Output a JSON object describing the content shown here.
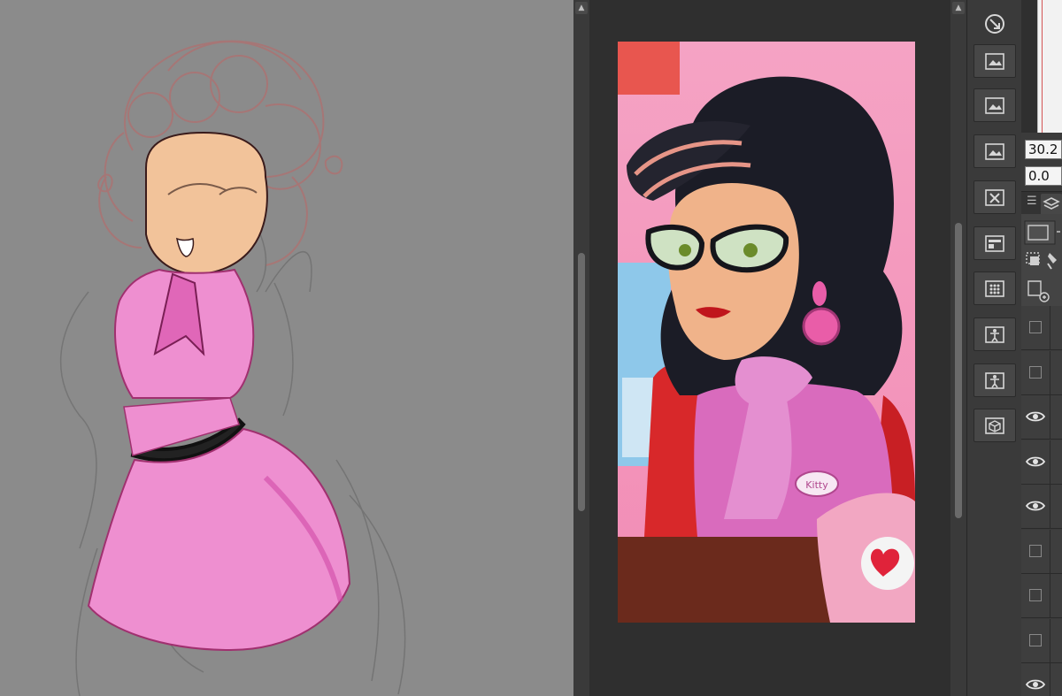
{
  "colors": {
    "canvas_bg": "#8b8b8b",
    "dress_pink": "#ee8fd0",
    "skin": "#f2c39a",
    "panel_dark": "#2f2f2f",
    "toolbar": "#3a3a3a"
  },
  "canvas": {
    "scroll_up_glyph": "▲"
  },
  "reference": {
    "scroll_up_glyph": "▲",
    "badge_text": "Kitty"
  },
  "toolbar": {
    "buttons": [
      {
        "icon": "rotate-view-icon"
      },
      {
        "icon": "folder-image-icon"
      },
      {
        "icon": "folder-image-icon"
      },
      {
        "icon": "folder-image-icon"
      },
      {
        "icon": "layer-mask-icon"
      },
      {
        "icon": "layout-icon"
      },
      {
        "icon": "dot-grid-icon"
      },
      {
        "icon": "figure-pose-icon"
      },
      {
        "icon": "figure-pose-icon"
      },
      {
        "icon": "3d-object-icon"
      }
    ]
  },
  "navigator": {
    "angle_value": "30.2",
    "flip_value": "0.0"
  },
  "layers": {
    "menu_glyph": "☰",
    "rows": [
      {
        "visible": false
      },
      {
        "visible": false
      },
      {
        "visible": true
      },
      {
        "visible": true
      },
      {
        "visible": true
      },
      {
        "visible": false
      },
      {
        "visible": false
      },
      {
        "visible": false
      },
      {
        "visible": true
      }
    ]
  }
}
